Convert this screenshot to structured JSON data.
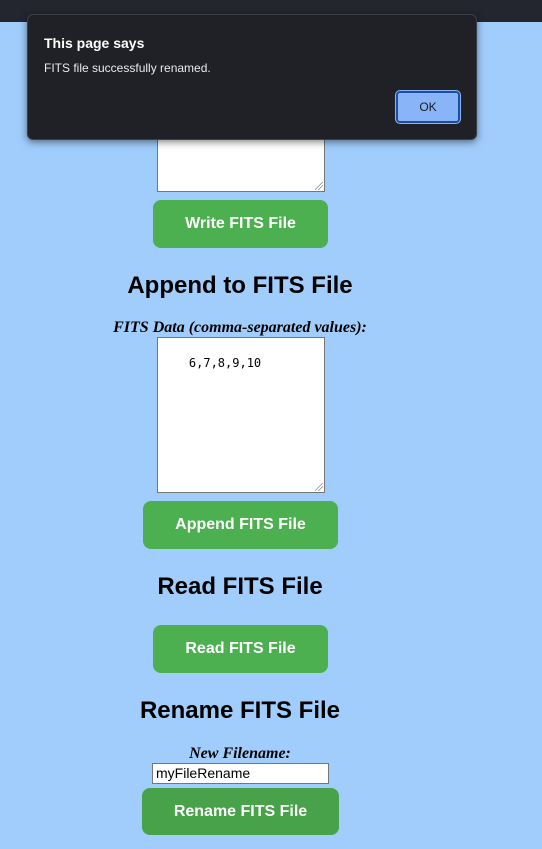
{
  "write_section": {
    "data_value": "",
    "button_label": "Write FITS File"
  },
  "append_section": {
    "heading": "Append to FITS File",
    "data_label": "FITS Data (comma-separated values):",
    "data_value": "6,7,8,9,10",
    "button_label": "Append FITS File"
  },
  "read_section": {
    "heading": "Read FITS File",
    "button_label": "Read FITS File"
  },
  "rename_section": {
    "heading": "Rename FITS File",
    "filename_label": "New Filename:",
    "filename_value": "myFileRename",
    "button_label": "Rename FITS File"
  },
  "dialog": {
    "title": "This page says",
    "message": "FITS file successfully renamed.",
    "ok_label": "OK"
  },
  "colors": {
    "page_background": "#a0cdfc",
    "button_green": "#4caf50",
    "dialog_background": "#1f2126",
    "ok_button": "#8ab4f8"
  }
}
